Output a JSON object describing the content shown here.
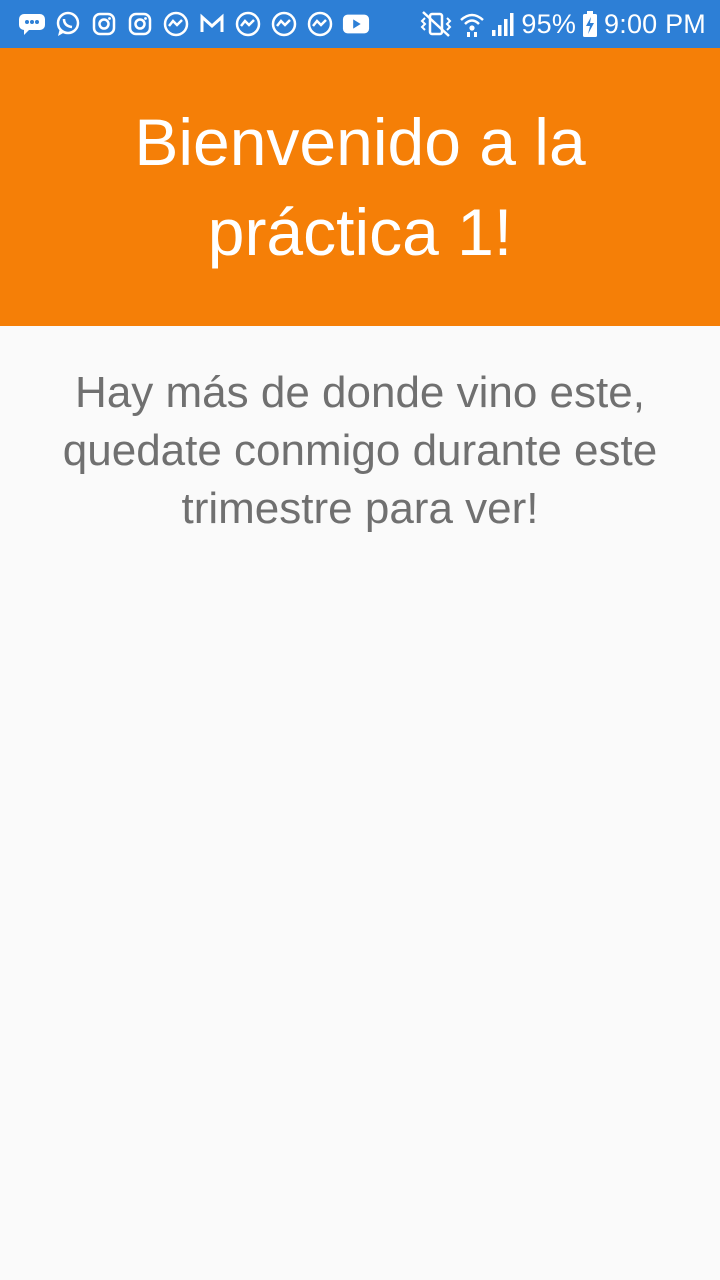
{
  "status_bar": {
    "notification_icons": [
      "chat-bubble-icon",
      "whatsapp-icon",
      "instagram-icon",
      "instagram-icon",
      "messenger-icon",
      "gmail-icon",
      "messenger-icon",
      "messenger-icon",
      "messenger-icon",
      "youtube-icon"
    ],
    "battery": "95%",
    "time": "9:00 PM",
    "background_color": "#2d7fd6"
  },
  "app_bar": {
    "title": "Bienvenido a la práctica 1!",
    "background_color": "#f57f07"
  },
  "content": {
    "message": "Hay más de donde vino este, quedate conmigo durante este trimestre para ver!",
    "text_color": "#707070"
  }
}
